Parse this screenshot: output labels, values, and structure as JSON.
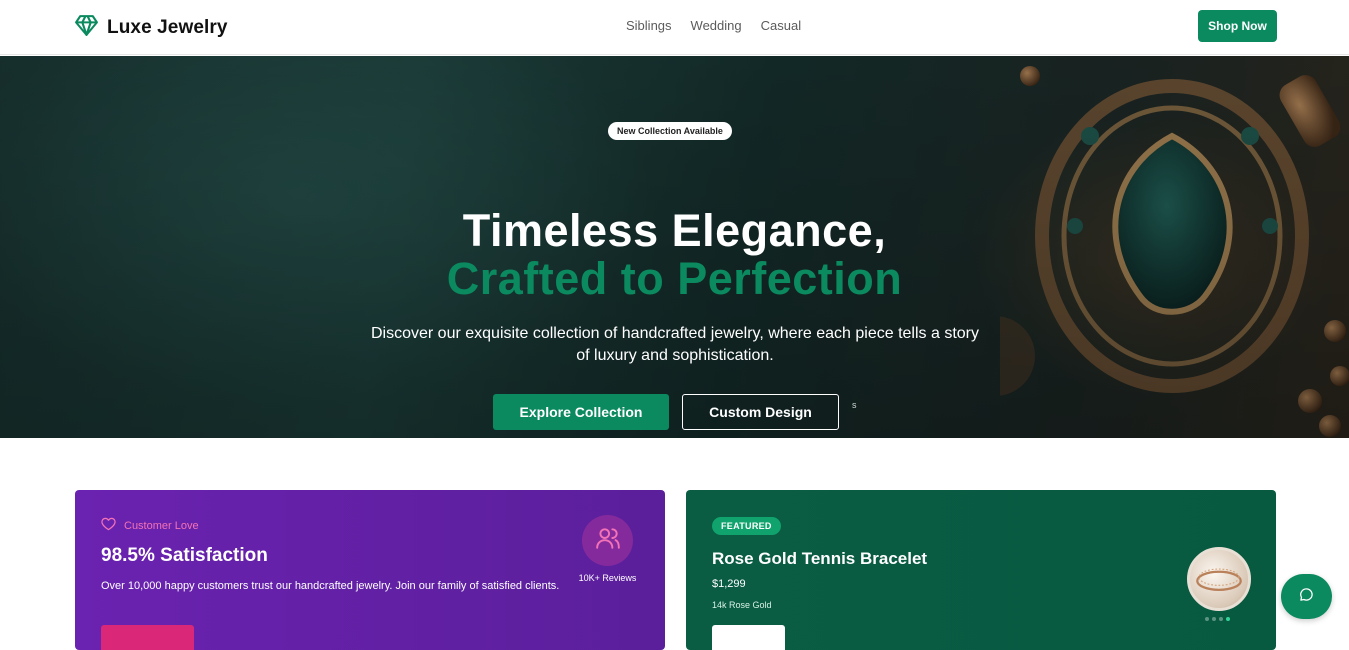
{
  "nav": {
    "brand": "Luxe Jewelry",
    "links": [
      "Siblings",
      "Wedding",
      "Casual"
    ],
    "cta": "Shop Now"
  },
  "hero": {
    "badge": "New Collection Available",
    "title_line1": "Timeless Elegance,",
    "title_line2": "Crafted to Perfection",
    "subtitle": "Discover our exquisite collection of handcrafted jewelry, where each piece tells a story of luxury and sophistication.",
    "primary_button": "Explore Collection",
    "secondary_button": "Custom Design",
    "stray_text": "s"
  },
  "love_card": {
    "label": "Customer Love",
    "title": "98.5% Satisfaction",
    "description": "Over 10,000 happy customers trust our handcrafted jewelry. Join our family of satisfied clients.",
    "reviews": "10K+ Reviews"
  },
  "featured_card": {
    "badge": "FEATURED",
    "title": "Rose Gold Tennis Bracelet",
    "price": "$1,299",
    "meta": "14k Rose Gold",
    "carousel_dots": 4,
    "active_dot": 3
  },
  "colors": {
    "brand_green": "#0b8a5f",
    "purple_card": "#6a22b0",
    "pink_accent": "#f472b6",
    "green_card": "#0a5c43"
  },
  "icons": [
    "gem-icon",
    "heart-icon",
    "users-icon",
    "chat-icon"
  ]
}
